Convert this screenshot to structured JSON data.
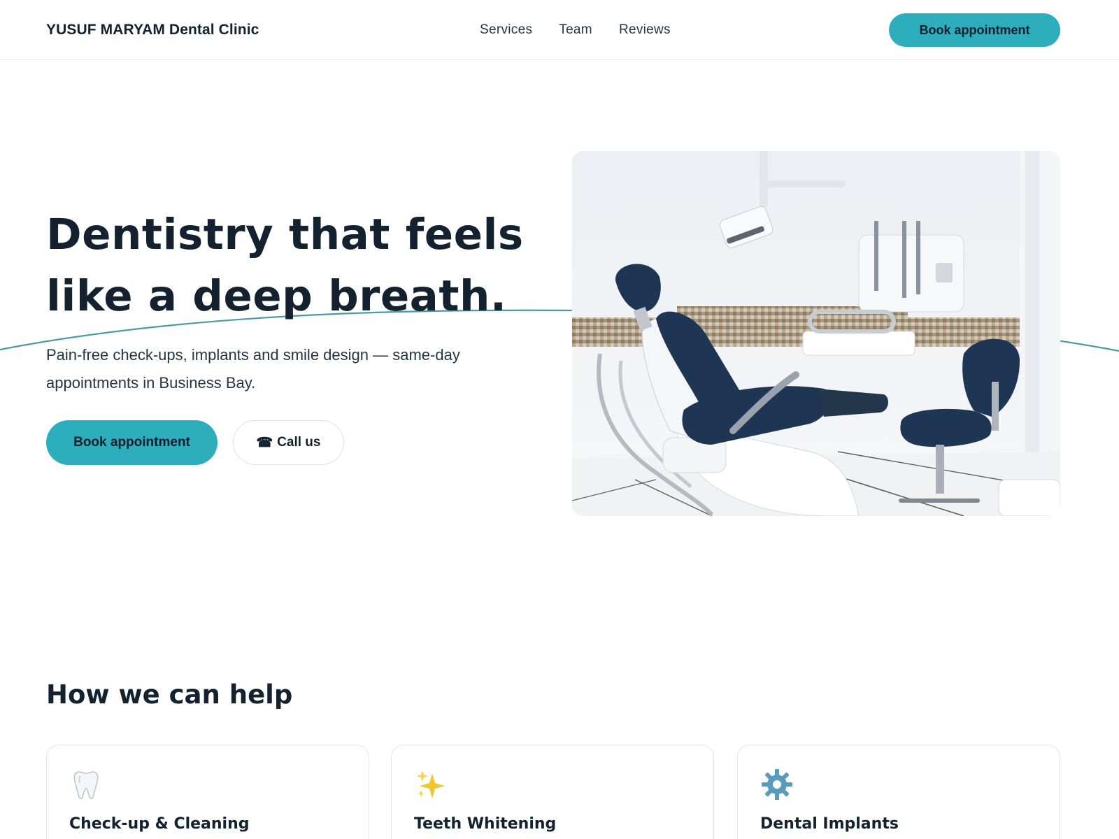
{
  "header": {
    "brand": "YUSUF MARYAM Dental Clinic",
    "nav": [
      "Services",
      "Team",
      "Reviews"
    ],
    "cta_label": "Book appointment"
  },
  "hero": {
    "title_line1": "Dentistry that feels",
    "title_line2": "like a deep breath.",
    "subtitle": "Pain-free check-ups, implants and smile design — same-day appointments in Business Bay.",
    "primary_label": "Book appointment",
    "secondary_icon": "☎",
    "secondary_label": "Call us",
    "image_icon": "dental-chair-photo"
  },
  "services": {
    "title": "How we can help",
    "cards": [
      {
        "icon": "tooth-icon",
        "title": "Check-up & Cleaning"
      },
      {
        "icon": "sparkles-icon",
        "title": "Teeth Whitening"
      },
      {
        "icon": "gear-icon",
        "title": "Dental Implants"
      }
    ]
  },
  "colors": {
    "accent": "#2eadbc",
    "text": "#13222e",
    "chair": "#1e3554"
  }
}
